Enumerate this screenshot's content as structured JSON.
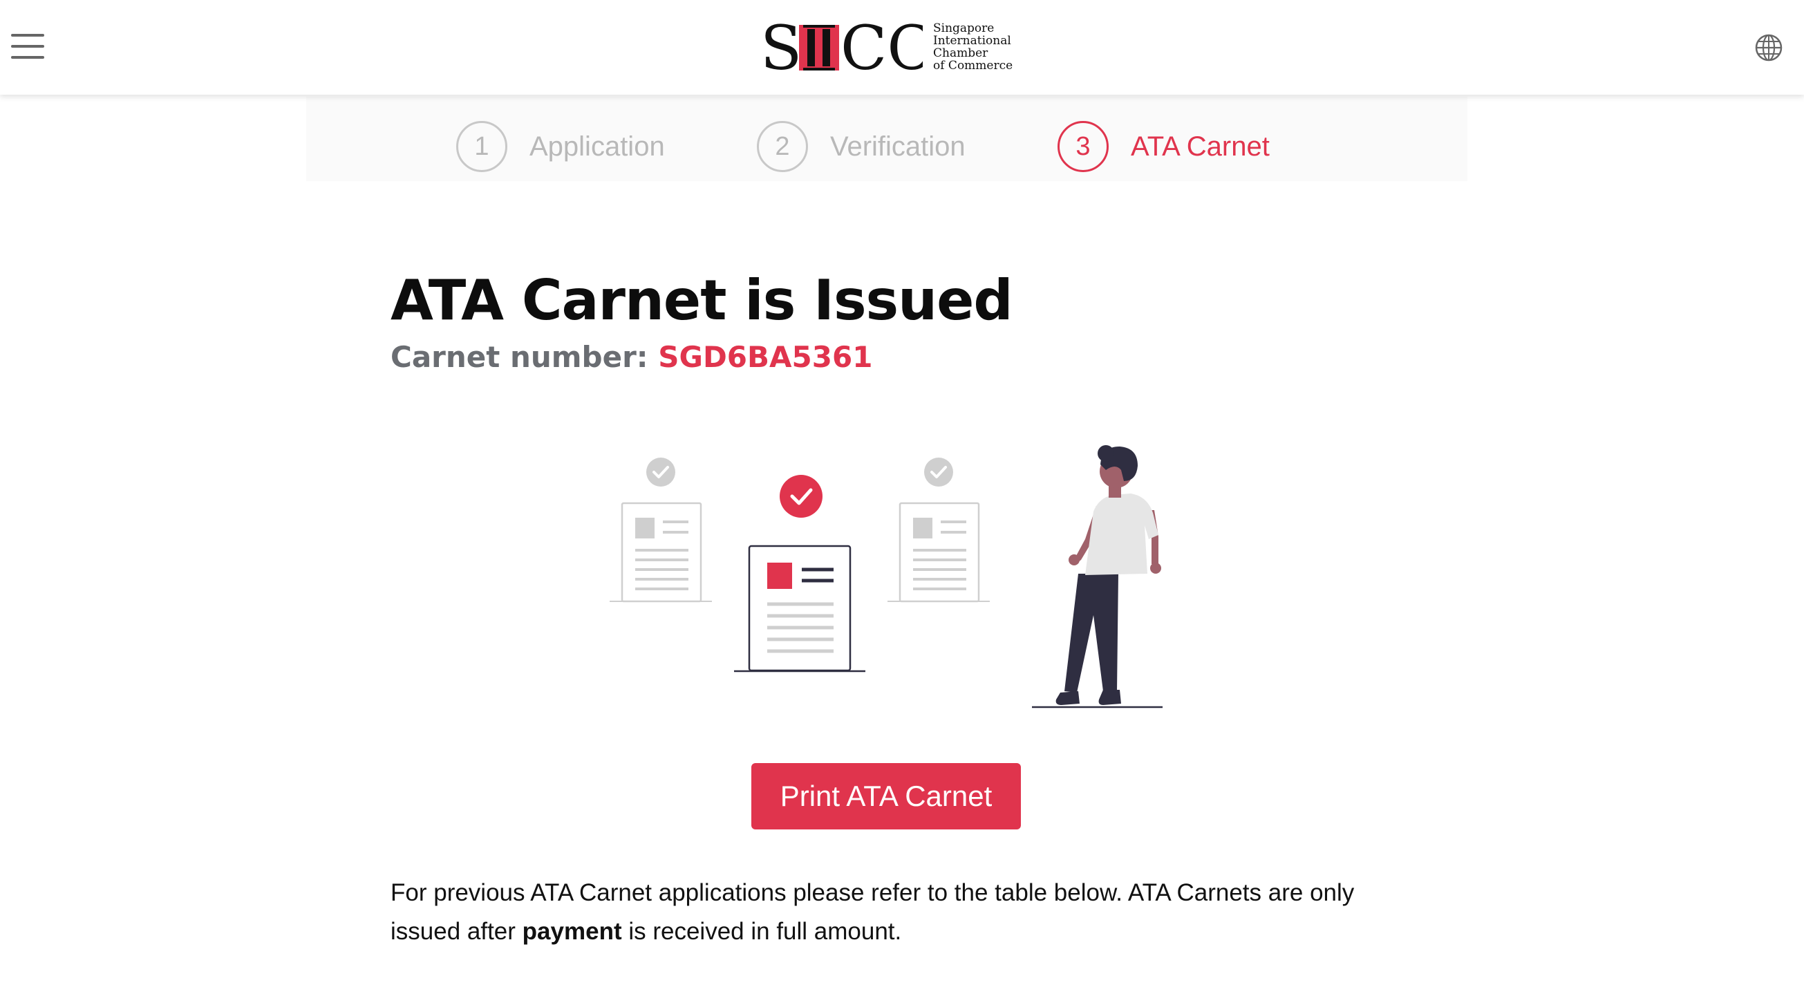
{
  "header": {
    "logo": {
      "mark": "SICC",
      "lines": [
        "Singapore",
        "International",
        "Chamber",
        "of Commerce"
      ]
    },
    "menu_icon": "hamburger-menu-icon",
    "language_icon": "globe-icon"
  },
  "stepper": {
    "steps": [
      {
        "number": "1",
        "label": "Application",
        "state": "inactive"
      },
      {
        "number": "2",
        "label": "Verification",
        "state": "inactive"
      },
      {
        "number": "3",
        "label": "ATA Carnet",
        "state": "active"
      }
    ]
  },
  "main": {
    "title": "ATA Carnet is Issued",
    "carnet_label": "Carnet number:",
    "carnet_number": "SGD6BA5361",
    "print_button": "Print ATA Carnet",
    "info": {
      "part1": "For previous ATA Carnet applications please refer to the table below. ATA Carnets are only issued after",
      "bold": "payment",
      "part2": "is received in full amount."
    }
  },
  "colors": {
    "accent": "#e0344d",
    "muted": "#b8b8b8",
    "dark": "#2f2e41"
  }
}
